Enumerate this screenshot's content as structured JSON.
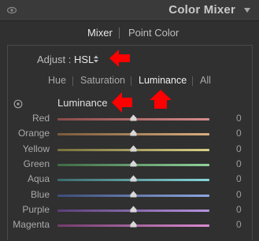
{
  "panel": {
    "title": "Color Mixer"
  },
  "mode_tabs": {
    "mixer": "Mixer",
    "point_color": "Point Color"
  },
  "adjust": {
    "label": "Adjust :",
    "value": "HSL"
  },
  "property_tabs": [
    {
      "label": "Hue",
      "active": false
    },
    {
      "label": "Saturation",
      "active": false
    },
    {
      "label": "Luminance",
      "active": true
    },
    {
      "label": "All",
      "active": false
    }
  ],
  "section": {
    "label": "Luminance"
  },
  "sliders": [
    {
      "name": "Red",
      "value": "0",
      "level": 0.5,
      "colors": [
        "#8a4a4a",
        "#d68c8c"
      ]
    },
    {
      "name": "Orange",
      "value": "0",
      "level": 0.5,
      "colors": [
        "#7a5a3c",
        "#d9ae7e"
      ]
    },
    {
      "name": "Yellow",
      "value": "0",
      "level": 0.5,
      "colors": [
        "#78703c",
        "#d8cf86"
      ]
    },
    {
      "name": "Green",
      "value": "0",
      "level": 0.5,
      "colors": [
        "#3f6a45",
        "#8fd29a"
      ]
    },
    {
      "name": "Aqua",
      "value": "0",
      "level": 0.5,
      "colors": [
        "#3b6b6d",
        "#86d6d8"
      ]
    },
    {
      "name": "Blue",
      "value": "0",
      "level": 0.5,
      "colors": [
        "#3c4d78",
        "#8ea6e0"
      ]
    },
    {
      "name": "Purple",
      "value": "0",
      "level": 0.5,
      "colors": [
        "#5a3f78",
        "#b493dd"
      ]
    },
    {
      "name": "Magenta",
      "value": "0",
      "level": 0.5,
      "colors": [
        "#733c6b",
        "#d98bcf"
      ]
    }
  ],
  "colors": {
    "annotation": "#ff0000",
    "thumb": "#d7d7d7"
  }
}
